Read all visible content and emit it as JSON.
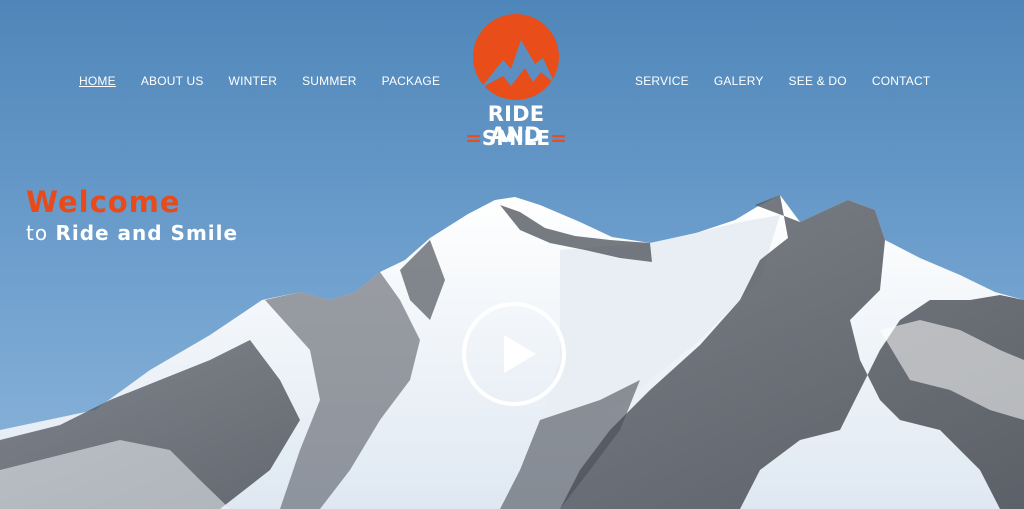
{
  "nav_left": [
    "HOME",
    "ABOUT US",
    "WINTER",
    "SUMMER",
    "PACKAGE"
  ],
  "nav_right": [
    "SERVICE",
    "GALERY",
    "SEE & DO",
    "CONTACT"
  ],
  "logo": {
    "line1": "RIDE AND",
    "line2": "SMILE",
    "bars": "="
  },
  "welcome": {
    "title": "Welcome",
    "to": "to",
    "name": "Ride and Smile"
  },
  "colors": {
    "accent": "#e84d1a",
    "sky": "#5b8fc2",
    "text": "#ffffff"
  },
  "icons": {
    "logo": "mountain-sun-logo-icon",
    "play": "play-icon"
  }
}
